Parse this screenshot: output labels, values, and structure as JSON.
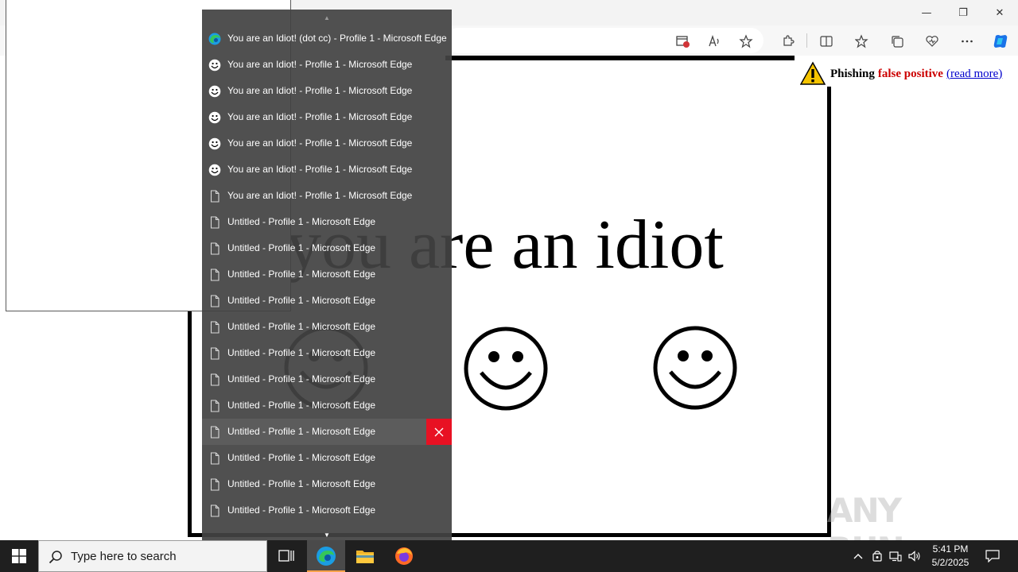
{
  "browser": {
    "window_controls": {
      "minimize": "—",
      "restore": "❐",
      "close": "✕"
    }
  },
  "page": {
    "headline": "you are an idiot",
    "phishing_notice": {
      "word1": "Phishing",
      "word2": "false positive",
      "link": "(read more)"
    }
  },
  "watermark": {
    "text": "ANY RUN"
  },
  "jump_list": {
    "items": [
      {
        "label": "You are an Idiot! (dot cc) - Profile 1 - Microsoft Edge",
        "icon": "edge-icon"
      },
      {
        "label": "You are an Idiot! - Profile 1 - Microsoft Edge",
        "icon": "smiley-icon"
      },
      {
        "label": "You are an Idiot! - Profile 1 - Microsoft Edge",
        "icon": "smiley-icon"
      },
      {
        "label": "You are an Idiot! - Profile 1 - Microsoft Edge",
        "icon": "smiley-icon"
      },
      {
        "label": "You are an Idiot! - Profile 1 - Microsoft Edge",
        "icon": "smiley-icon"
      },
      {
        "label": "You are an Idiot! - Profile 1 - Microsoft Edge",
        "icon": "smiley-icon"
      },
      {
        "label": "You are an Idiot! - Profile 1 - Microsoft Edge",
        "icon": "page-icon"
      },
      {
        "label": "Untitled - Profile 1 - Microsoft Edge",
        "icon": "page-icon"
      },
      {
        "label": "Untitled - Profile 1 - Microsoft Edge",
        "icon": "page-icon"
      },
      {
        "label": "Untitled - Profile 1 - Microsoft Edge",
        "icon": "page-icon"
      },
      {
        "label": "Untitled - Profile 1 - Microsoft Edge",
        "icon": "page-icon"
      },
      {
        "label": "Untitled - Profile 1 - Microsoft Edge",
        "icon": "page-icon"
      },
      {
        "label": "Untitled - Profile 1 - Microsoft Edge",
        "icon": "page-icon"
      },
      {
        "label": "Untitled - Profile 1 - Microsoft Edge",
        "icon": "page-icon"
      },
      {
        "label": "Untitled - Profile 1 - Microsoft Edge",
        "icon": "page-icon"
      },
      {
        "label": "Untitled - Profile 1 - Microsoft Edge",
        "icon": "page-icon",
        "active": true
      },
      {
        "label": "Untitled - Profile 1 - Microsoft Edge",
        "icon": "page-icon"
      },
      {
        "label": "Untitled - Profile 1 - Microsoft Edge",
        "icon": "page-icon"
      },
      {
        "label": "Untitled - Profile 1 - Microsoft Edge",
        "icon": "page-icon"
      }
    ]
  },
  "taskbar": {
    "search_placeholder": "Type here to search",
    "time": "5:41 PM",
    "date": "5/2/2025",
    "colors": {
      "active_indicator": "#ffa24a",
      "close_hover": "#e81123"
    }
  }
}
